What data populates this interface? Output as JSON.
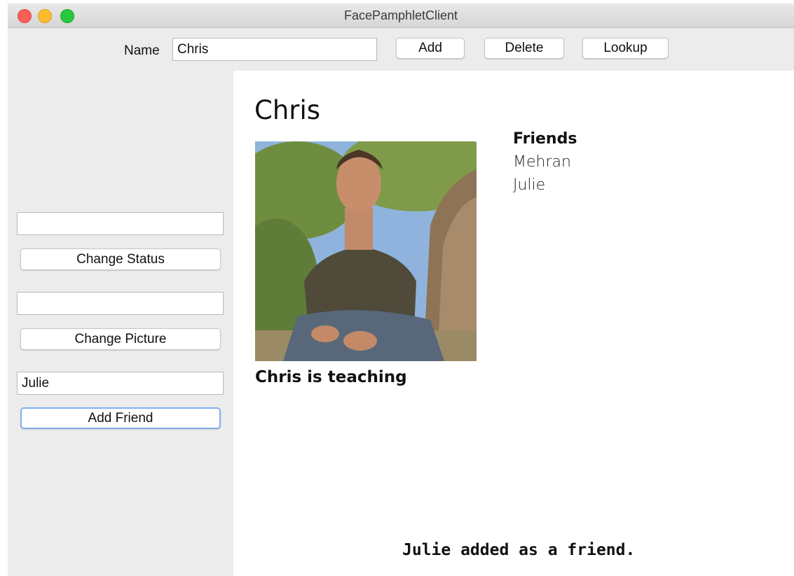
{
  "window": {
    "title": "FacePamphletClient"
  },
  "toolbar": {
    "name_label": "Name",
    "name_value": "Chris",
    "add_label": "Add",
    "delete_label": "Delete",
    "lookup_label": "Lookup"
  },
  "sidebar": {
    "status_input_value": "",
    "change_status_label": "Change Status",
    "picture_input_value": "",
    "change_picture_label": "Change Picture",
    "friend_input_value": "Julie",
    "add_friend_label": "Add Friend"
  },
  "profile": {
    "name": "Chris",
    "status": "Chris is teaching",
    "friends_heading": "Friends",
    "friends": [
      "Mehran",
      "Julie"
    ]
  },
  "message": "Julie added as a friend."
}
